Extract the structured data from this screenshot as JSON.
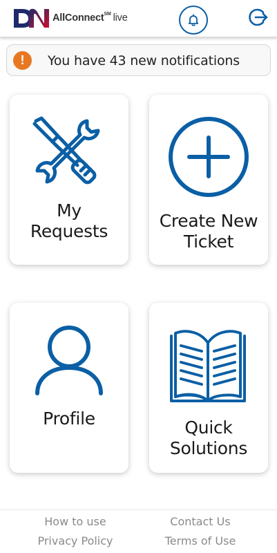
{
  "header": {
    "logo_mark_text": "DN",
    "brand_name": "AllConnect",
    "brand_mark": "SM",
    "brand_suffix": "live",
    "bell_icon": "bell-icon",
    "logout_icon": "logout-icon"
  },
  "notification": {
    "icon": "exclamation-icon",
    "text": "You have 43 new notifications"
  },
  "tiles": [
    {
      "label": "My\nRequests",
      "icon": "tools-icon"
    },
    {
      "label": "Create New\nTicket",
      "icon": "plus-circle-icon"
    },
    {
      "label": "Profile",
      "icon": "user-icon"
    },
    {
      "label": "Quick\nSolutions",
      "icon": "book-icon"
    }
  ],
  "footer": {
    "links": [
      "How to use",
      "Contact Us",
      "Privacy Policy",
      "Terms of Use"
    ]
  },
  "colors": {
    "accent": "#0b5fa5",
    "alert": "#e87722",
    "logo_navy": "#1f2a6b",
    "logo_red": "#c8102e",
    "footer_text": "#8a8a8a"
  }
}
